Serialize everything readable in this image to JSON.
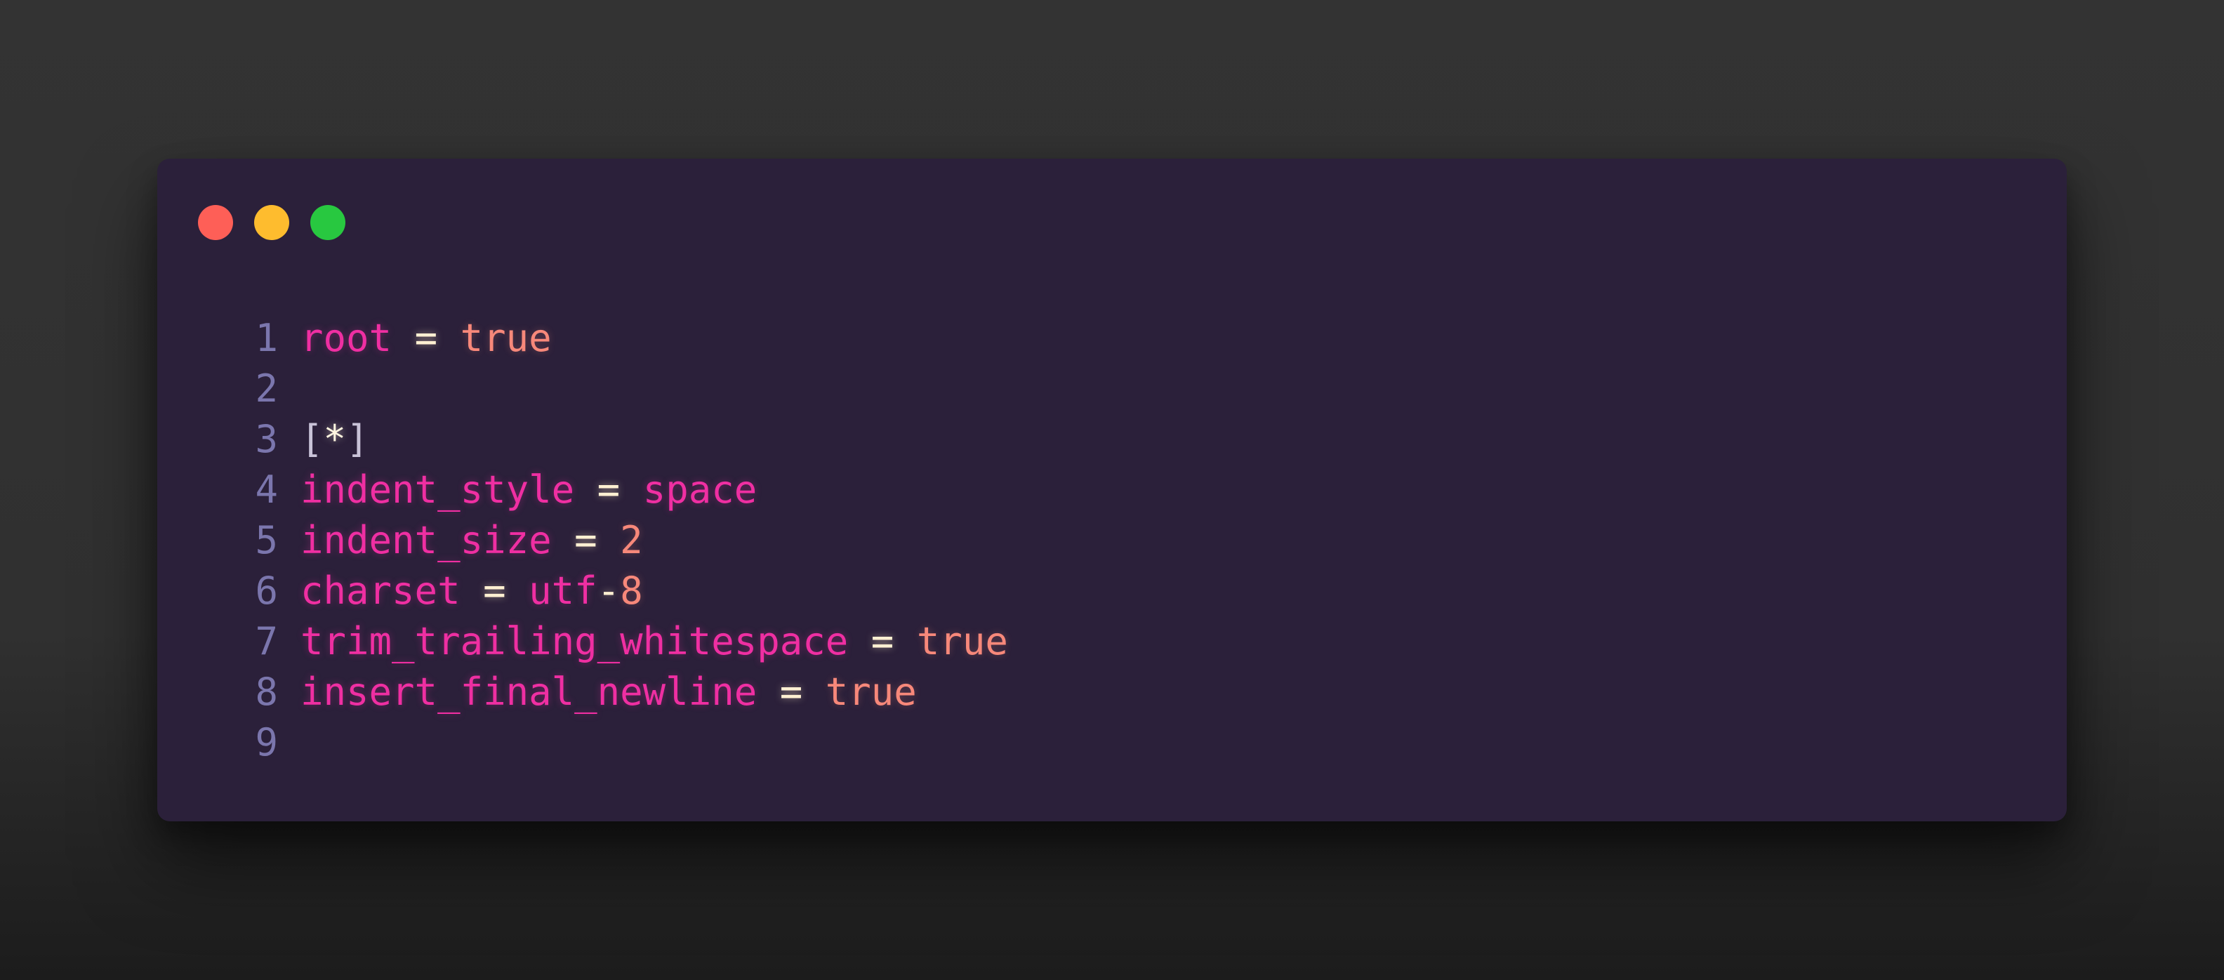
{
  "window": {
    "controls": [
      {
        "name": "close",
        "color": "#fe5f57"
      },
      {
        "name": "minimize",
        "color": "#febc2e"
      },
      {
        "name": "zoom",
        "color": "#28c840"
      }
    ]
  },
  "code": {
    "language": "editorconfig",
    "lines": [
      {
        "number": "1",
        "tokens": [
          {
            "t": "root",
            "k": "key"
          },
          {
            "t": " ",
            "k": "sp"
          },
          {
            "t": "=",
            "k": "op"
          },
          {
            "t": " ",
            "k": "sp"
          },
          {
            "t": "true",
            "k": "val"
          }
        ]
      },
      {
        "number": "2",
        "tokens": []
      },
      {
        "number": "3",
        "tokens": [
          {
            "t": "[",
            "k": "br"
          },
          {
            "t": "*",
            "k": "star"
          },
          {
            "t": "]",
            "k": "br"
          }
        ]
      },
      {
        "number": "4",
        "tokens": [
          {
            "t": "indent_style",
            "k": "key"
          },
          {
            "t": " ",
            "k": "sp"
          },
          {
            "t": "=",
            "k": "op"
          },
          {
            "t": " ",
            "k": "sp"
          },
          {
            "t": "space",
            "k": "key"
          }
        ]
      },
      {
        "number": "5",
        "tokens": [
          {
            "t": "indent_size",
            "k": "key"
          },
          {
            "t": " ",
            "k": "sp"
          },
          {
            "t": "=",
            "k": "op"
          },
          {
            "t": " ",
            "k": "sp"
          },
          {
            "t": "2",
            "k": "val"
          }
        ]
      },
      {
        "number": "6",
        "tokens": [
          {
            "t": "charset",
            "k": "key"
          },
          {
            "t": " ",
            "k": "sp"
          },
          {
            "t": "=",
            "k": "op"
          },
          {
            "t": " ",
            "k": "sp"
          },
          {
            "t": "utf",
            "k": "key"
          },
          {
            "t": "-",
            "k": "op"
          },
          {
            "t": "8",
            "k": "val"
          }
        ]
      },
      {
        "number": "7",
        "tokens": [
          {
            "t": "trim_trailing_whitespace",
            "k": "key"
          },
          {
            "t": " ",
            "k": "sp"
          },
          {
            "t": "=",
            "k": "op"
          },
          {
            "t": " ",
            "k": "sp"
          },
          {
            "t": "true",
            "k": "val"
          }
        ]
      },
      {
        "number": "8",
        "tokens": [
          {
            "t": "insert_final_newline",
            "k": "key"
          },
          {
            "t": " ",
            "k": "sp"
          },
          {
            "t": "=",
            "k": "op"
          },
          {
            "t": " ",
            "k": "sp"
          },
          {
            "t": "true",
            "k": "val"
          }
        ]
      },
      {
        "number": "9",
        "tokens": []
      }
    ]
  },
  "colors": {
    "background": "#333333",
    "window": "#2b203a",
    "line_number": "#7b76ad",
    "key": "#ef2fa2",
    "operator": "#fff0d2",
    "value": "#f7887a"
  }
}
